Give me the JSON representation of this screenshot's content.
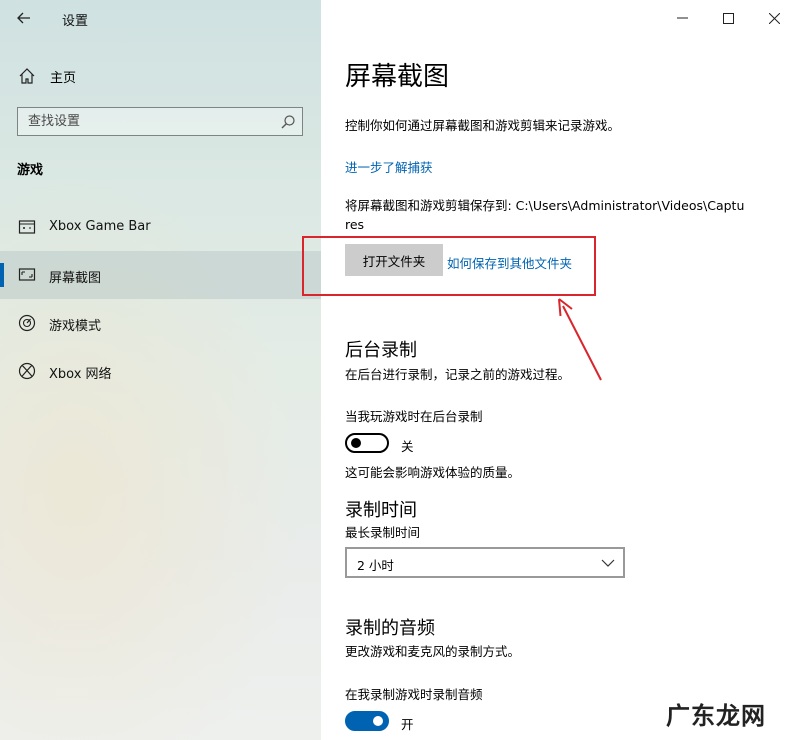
{
  "window": {
    "title": "设置"
  },
  "sidebar": {
    "home_label": "主页",
    "search_placeholder": "查找设置",
    "section_title": "游戏",
    "items": [
      {
        "label": "Xbox Game Bar"
      },
      {
        "label": "屏幕截图",
        "active": true
      },
      {
        "label": "游戏模式"
      },
      {
        "label": "Xbox 网络"
      }
    ]
  },
  "main": {
    "title": "屏幕截图",
    "description": "控制你如何通过屏幕截图和游戏剪辑来记录游戏。",
    "learn_more": "进一步了解捕获",
    "save_path": "将屏幕截图和游戏剪辑保存到: C:\\Users\\Administrator\\Videos\\Captures",
    "open_folder_button": "打开文件夹",
    "how_to_save_link": "如何保存到其他文件夹",
    "background_recording": {
      "heading": "后台录制",
      "description": "在后台进行录制，记录之前的游戏过程。",
      "toggle_label": "当我玩游戏时在后台录制",
      "toggle_state": "关",
      "note": "这可能会影响游戏体验的质量。"
    },
    "recording_time": {
      "heading": "录制时间",
      "label": "最长录制时间",
      "value": "2 小时"
    },
    "recorded_audio": {
      "heading": "录制的音频",
      "description": "更改游戏和麦克风的录制方式。",
      "toggle_label": "在我录制游戏时录制音频",
      "toggle_state": "开"
    }
  },
  "watermark": "广东龙网",
  "colors": {
    "accent": "#0063b1",
    "annotation": "#d9262c"
  }
}
